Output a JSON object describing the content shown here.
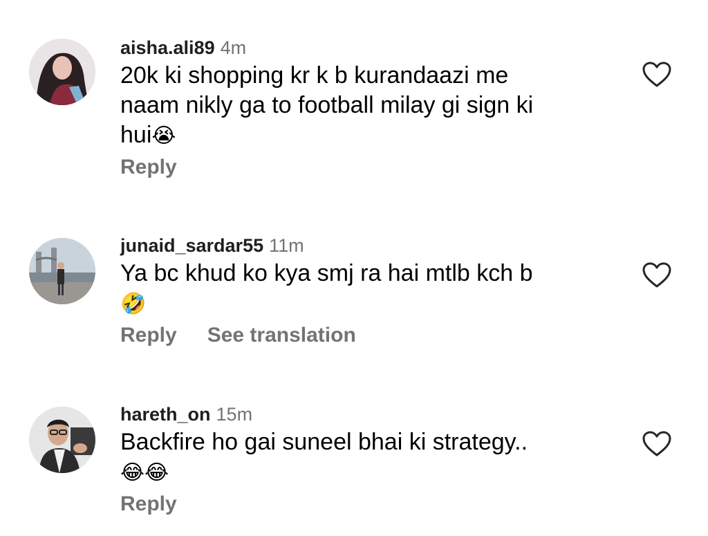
{
  "comments": [
    {
      "username": "aisha.ali89",
      "time": "4m",
      "lines": [
        "20k ki shopping kr k b kurandaazi me",
        "naam nikly ga to football milay gi sign ki",
        "hui"
      ],
      "emoji": "😭",
      "actions": [
        "Reply"
      ]
    },
    {
      "username": "junaid_sardar55",
      "time": "11m",
      "lines": [
        "Ya bc khud ko kya smj ra hai mtlb kch b"
      ],
      "emoji": "🤣",
      "actions": [
        "Reply",
        "See translation"
      ]
    },
    {
      "username": "hareth_on",
      "time": "15m",
      "lines": [
        "Backfire ho gai suneel bhai ki strategy.."
      ],
      "emoji": "😂😂",
      "actions": [
        "Reply"
      ]
    }
  ],
  "icons": {
    "like": "heart-outline-icon"
  },
  "colors": {
    "username": "#1f1f1f",
    "secondary": "#737373",
    "text": "#000000"
  }
}
